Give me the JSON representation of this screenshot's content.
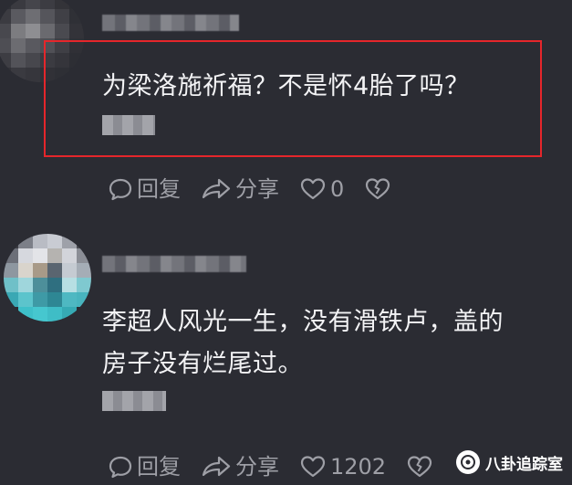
{
  "comments": [
    {
      "text": "为梁洛施祈福？不是怀4胎了吗？",
      "actions": {
        "reply_label": "回复",
        "share_label": "分享",
        "like_count": "0"
      }
    },
    {
      "text": "李超人风光一生，没有滑铁卢，盖的\n房子没有烂尾过。",
      "actions": {
        "reply_label": "回复",
        "share_label": "分享",
        "like_count": "1202"
      }
    }
  ],
  "watermark": {
    "text": "八卦追踪室"
  },
  "colors": {
    "background": "#2b2c33",
    "highlight_border": "#e5262b",
    "action_gray": "#9e9fa6"
  }
}
